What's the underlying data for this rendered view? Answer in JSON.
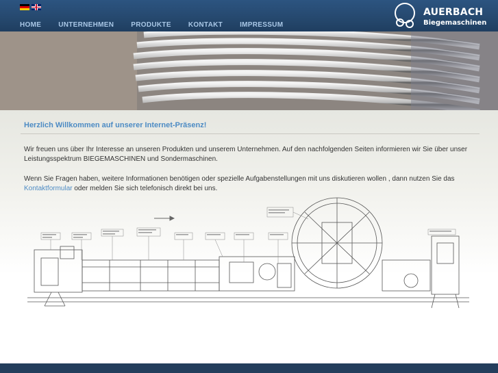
{
  "header": {
    "languages": [
      {
        "code": "de",
        "icon": "flag-de-icon"
      },
      {
        "code": "en",
        "icon": "flag-en-icon"
      }
    ],
    "nav": [
      {
        "label": "HOME"
      },
      {
        "label": "UNTERNEHMEN"
      },
      {
        "label": "PRODUKTE"
      },
      {
        "label": "KONTAKT"
      },
      {
        "label": "IMPRESSUM"
      }
    ],
    "logo": {
      "name": "AUERBACH",
      "tagline": "Biegemaschinen"
    }
  },
  "main": {
    "heading": "Herzlich Willkommen auf unserer Internet-Präsenz!",
    "paragraph1": "Wir freuen uns über Ihr Interesse an unseren Produkten und unserem Unternehmen. Auf den nachfolgenden Seiten informieren wir Sie über unser Leistungsspektrum BIEGEMASCHINEN und Sondermaschinen.",
    "paragraph2_before": "Wenn Sie Fragen haben, weitere Informationen benötigen oder spezielle Aufgabenstellungen mit uns diskutieren wollen , dann nutzen Sie das ",
    "paragraph2_link": "Kontaktformular",
    "paragraph2_after": " oder melden Sie sich telefonisch direkt bei uns."
  },
  "colors": {
    "header": "#26496f",
    "nav_text": "#a9c7e6",
    "heading": "#4d8bc4",
    "footer": "#243e5c"
  }
}
